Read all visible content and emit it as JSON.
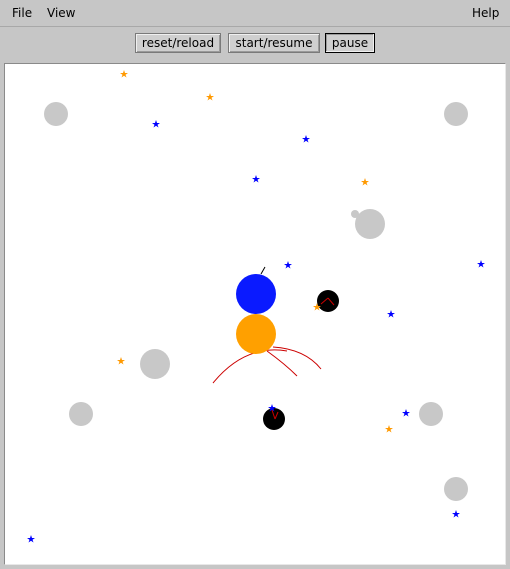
{
  "menubar": {
    "file": "File",
    "view": "View",
    "help": "Help"
  },
  "toolbar": {
    "reset_label": "reset/reload",
    "start_label": "start/resume",
    "pause_label": "pause"
  },
  "colors": {
    "background": "#c6c6c6",
    "canvas": "#ffffff",
    "player_blue": "#0a1aff",
    "player_orange": "#ffa000",
    "obstacle": "#c8c8c8",
    "enemy": "#000000",
    "tracer": "#cc0000",
    "star_blue": "#0000ff",
    "star_orange": "#ff9900"
  }
}
